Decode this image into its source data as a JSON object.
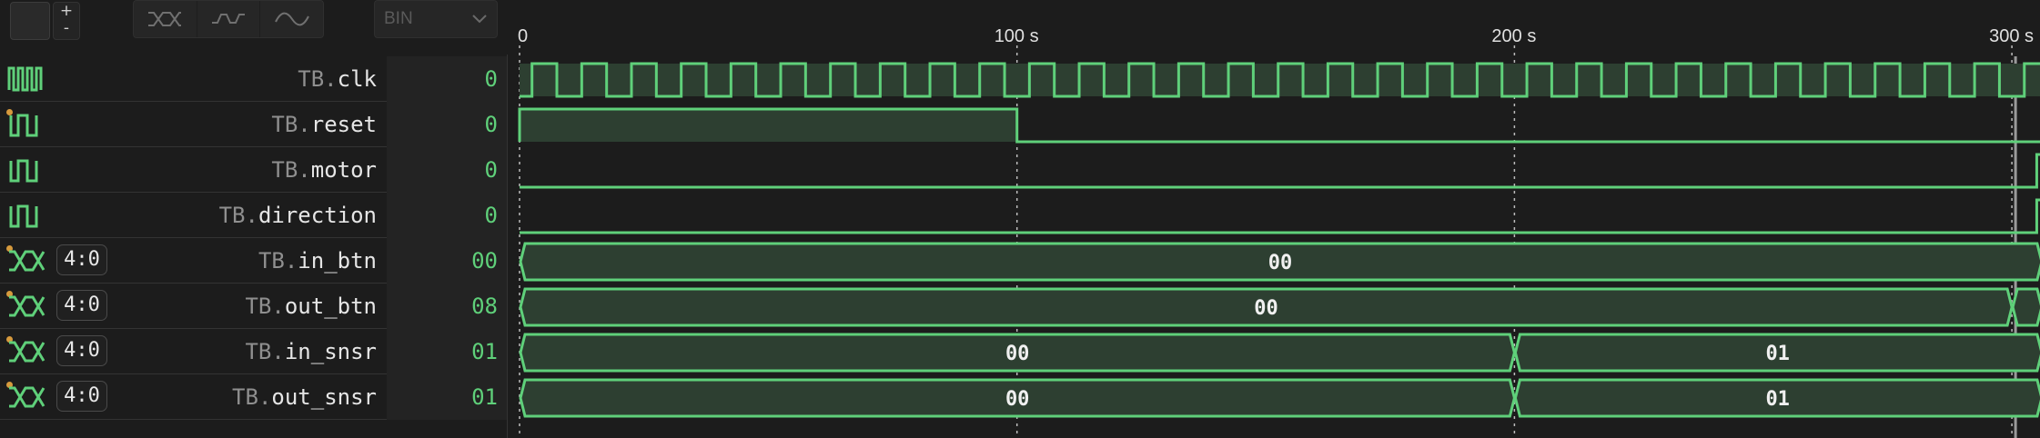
{
  "toolbar": {
    "zoom_plus": "+",
    "zoom_minus": "-",
    "style_buttons": [
      {
        "icon": "bus-waveform-icon"
      },
      {
        "icon": "step-waveform-icon"
      },
      {
        "icon": "analog-waveform-icon"
      }
    ],
    "radix": {
      "value": "BIN",
      "icon": "chevron-down-icon"
    }
  },
  "timeline": {
    "ticks": [
      {
        "label": "0",
        "time": 0
      },
      {
        "label": "100 s",
        "time": 100
      },
      {
        "label": "200 s",
        "time": 200
      },
      {
        "label": "300 s",
        "time": 300
      }
    ],
    "cursor_time": 300
  },
  "signals": [
    {
      "prefix": "TB.",
      "name": "clk",
      "value": "0",
      "icon": "clock-icon",
      "kind": "clock"
    },
    {
      "prefix": "TB.",
      "name": "reset",
      "value": "0",
      "icon": "pulse-icon",
      "kind": "bit",
      "marker": true
    },
    {
      "prefix": "TB.",
      "name": "motor",
      "value": "0",
      "icon": "pulse-icon",
      "kind": "bit"
    },
    {
      "prefix": "TB.",
      "name": "direction",
      "value": "0",
      "icon": "pulse-icon",
      "kind": "bit"
    },
    {
      "prefix": "TB.",
      "name": "in_btn",
      "value": "00",
      "icon": "bus-icon",
      "kind": "bus",
      "width": "4:0",
      "marker": true
    },
    {
      "prefix": "TB.",
      "name": "out_btn",
      "value": "08",
      "icon": "bus-icon",
      "kind": "bus",
      "width": "4:0",
      "marker": true
    },
    {
      "prefix": "TB.",
      "name": "in_snsr",
      "value": "01",
      "icon": "bus-icon",
      "kind": "bus",
      "width": "4:0",
      "marker": true
    },
    {
      "prefix": "TB.",
      "name": "out_snsr",
      "value": "01",
      "icon": "bus-icon",
      "kind": "bus",
      "width": "4:0",
      "marker": true
    }
  ],
  "waveforms": {
    "clk": {
      "period": 10
    },
    "reset": {
      "high_until": 100
    },
    "motor": {
      "rises_at": 305
    },
    "direction": {
      "rises_at": 305
    },
    "in_btn": [
      {
        "start": 0,
        "end": 306,
        "label": "00"
      }
    ],
    "out_btn": [
      {
        "start": 0,
        "end": 300,
        "label": "00"
      },
      {
        "start": 300,
        "end": 306,
        "label": ""
      }
    ],
    "in_snsr": [
      {
        "start": 0,
        "end": 200,
        "label": "00"
      },
      {
        "start": 200,
        "end": 306,
        "label": "01"
      }
    ],
    "out_snsr": [
      {
        "start": 0,
        "end": 200,
        "label": "00"
      },
      {
        "start": 200,
        "end": 306,
        "label": "01"
      }
    ]
  },
  "colors": {
    "wave": "#5fd07a",
    "fill": "#2d3f31",
    "marker": "#d69a3d",
    "grid": "#d8d8d8"
  }
}
